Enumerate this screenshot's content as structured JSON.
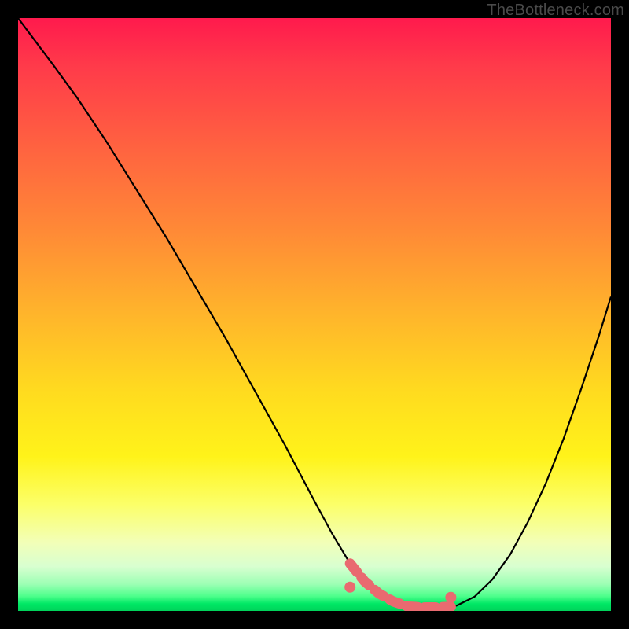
{
  "watermark": "TheBottleneck.com",
  "colors": {
    "background": "#000000",
    "curve": "#000000",
    "marker": "#e96a70",
    "watermark": "#4a4a4a"
  },
  "chart_data": {
    "type": "line",
    "title": "",
    "xlabel": "",
    "ylabel": "",
    "xlim": [
      0,
      100
    ],
    "ylim": [
      0,
      100
    ],
    "series": [
      {
        "name": "curve",
        "x": [
          0,
          3,
          6,
          10,
          15,
          20,
          25,
          30,
          35,
          40,
          45,
          50,
          53,
          56,
          59,
          62,
          65,
          68,
          71,
          74,
          77,
          80,
          83,
          86,
          89,
          92,
          95,
          98,
          100
        ],
        "y": [
          100,
          96,
          92,
          86.5,
          79,
          71,
          63,
          54.5,
          46,
          37,
          28,
          18.5,
          13,
          8,
          4.3,
          2.1,
          0.9,
          0.3,
          0.3,
          0.9,
          2.4,
          5.3,
          9.5,
          15,
          21.5,
          29,
          37.5,
          46.5,
          53
        ]
      }
    ],
    "annotations": {
      "marker_band_x": [
        56,
        73
      ],
      "marker_band_y": 0.6,
      "marker_end_caps": [
        {
          "x": 56,
          "y": 4.0
        },
        {
          "x": 73,
          "y": 2.3
        }
      ]
    }
  }
}
